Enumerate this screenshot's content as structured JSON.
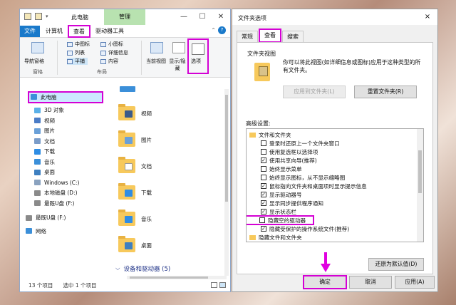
{
  "explorer": {
    "title": "此电脑",
    "manage_tab": "管理",
    "tabs": [
      "文件",
      "计算机",
      "查看",
      "驱动器工具"
    ],
    "ribbon": {
      "nav_pane": "导航窗格",
      "pane_group": "窗格",
      "layout_items": [
        "中图标",
        "小图标",
        "列表",
        "详细信息",
        "平铺",
        "内容"
      ],
      "layout_group": "布局",
      "current_view": "当前视图",
      "show_hide": "显示/隐藏",
      "options": "选项"
    },
    "nav_items": [
      {
        "label": "此电脑",
        "color": "#3b8fd9"
      },
      {
        "label": "3D 对象",
        "color": "#5ab0e8"
      },
      {
        "label": "视频",
        "color": "#4a7cc7"
      },
      {
        "label": "图片",
        "color": "#6aa0d8"
      },
      {
        "label": "文档",
        "color": "#7a9cc9"
      },
      {
        "label": "下载",
        "color": "#2f8de4"
      },
      {
        "label": "音乐",
        "color": "#3b8fd9"
      },
      {
        "label": "桌面",
        "color": "#3e7fc0"
      },
      {
        "label": "Windows (C:)",
        "color": "#8aa2bf"
      },
      {
        "label": "本地磁盘 (D:)",
        "color": "#8a8a8a"
      },
      {
        "label": "最既U盘 (F:)",
        "color": "#8a8a8a"
      },
      {
        "label": "最既U盘 (F:)",
        "color": "#8a8a8a"
      },
      {
        "label": "网络",
        "color": "#3b8fd9"
      }
    ],
    "content_items": [
      "视频",
      "图片",
      "文档",
      "下载",
      "音乐",
      "桌面"
    ],
    "devices_header": "设备和驱动器 (5)",
    "status": {
      "count": "13 个项目",
      "selected": "选中 1 个项目"
    }
  },
  "dialog": {
    "title": "文件夹选项",
    "close": "×",
    "tabs": [
      "常规",
      "查看",
      "搜索"
    ],
    "folder_views_label": "文件夹视图",
    "folder_views_desc": "你可以将此视图(如详细信息或图标)应用于这种类型的所有文件夹。",
    "apply_to_folders": "应用到文件夹(L)",
    "reset_folders": "重置文件夹(R)",
    "advanced_label": "高级设置:",
    "settings": [
      {
        "label": "文件和文件夹",
        "root": true
      },
      {
        "label": "登录时还原上一个文件夹窗口",
        "checked": false
      },
      {
        "label": "使用复选框以选择项",
        "checked": false
      },
      {
        "label": "使用共享向导(推荐)",
        "checked": true
      },
      {
        "label": "始终显示菜单",
        "checked": false
      },
      {
        "label": "始终显示图标，从不显示缩略图",
        "checked": false
      },
      {
        "label": "鼠标指向文件夹和桌面项时显示提示信息",
        "checked": true
      },
      {
        "label": "显示驱动器号",
        "checked": true
      },
      {
        "label": "显示同步提供程序通知",
        "checked": true
      },
      {
        "label": "显示状态栏",
        "checked": true
      },
      {
        "label": "隐藏空的驱动器",
        "checked": false
      },
      {
        "label": "隐藏受保护的操作系统文件(推荐)",
        "checked": true
      },
      {
        "label": "隐藏文件和文件夹",
        "root": true
      }
    ],
    "restore_defaults": "还原为默认值(D)",
    "ok": "确定",
    "cancel": "取消",
    "apply": "应用(A)"
  },
  "highlight_color": "#d400d4"
}
